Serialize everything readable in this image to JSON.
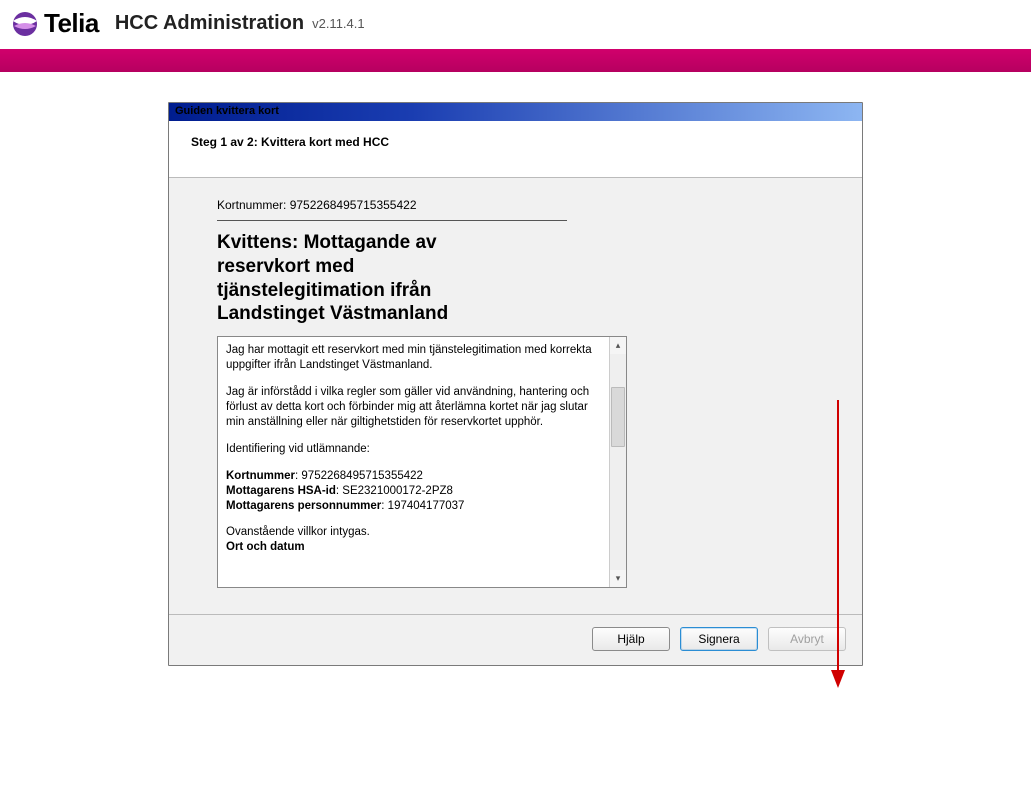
{
  "brand": {
    "name": "Telia"
  },
  "app": {
    "title": "HCC Administration",
    "version": "v2.11.4.1"
  },
  "wizard": {
    "title": "Guiden kvittera kort",
    "step": "Steg 1 av 2: Kvittera kort med HCC",
    "card_label": "Kortnummer:",
    "card_number": "9752268495715355422",
    "receipt_heading": "Kvittens: Mottagande av reservkort med tjänstelegitimation ifrån Landstinget Västmanland",
    "receipt": {
      "p1": "Jag har mottagit ett reservkort med min tjänstelegitimation med korrekta uppgifter ifrån Landstinget Västmanland.",
      "p2": "Jag är införstådd i vilka regler som gäller vid användning, hantering och förlust av detta kort och förbinder mig att återlämna kortet när jag slutar min anställning eller när giltighetstiden för reservkortet upphör.",
      "id_heading": "Identifiering vid utlämnande:",
      "kortnummer_label": "Kortnummer",
      "kortnummer_value": "9752268495715355422",
      "hsa_label": "Mottagarens HSA-id",
      "hsa_value": "SE2321000172-2PZ8",
      "pn_label": "Mottagarens personnummer",
      "pn_value": "197404177037",
      "confirm": "Ovanstående villkor intygas.",
      "place_date": "Ort och datum"
    }
  },
  "buttons": {
    "help": "Hjälp",
    "sign": "Signera",
    "cancel": "Avbryt"
  }
}
